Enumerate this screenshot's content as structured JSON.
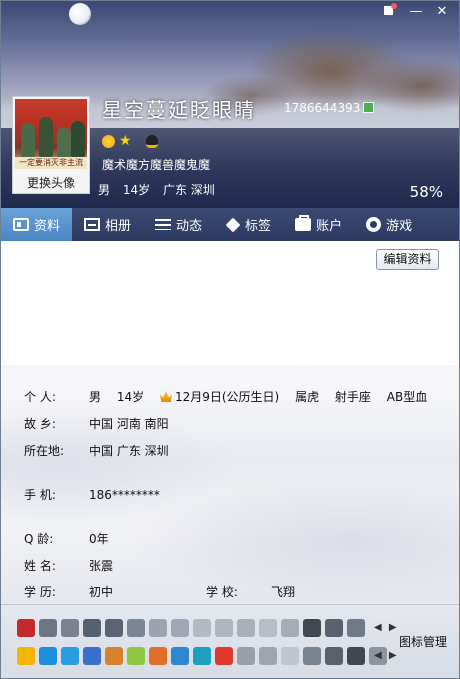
{
  "window": {
    "controls": {
      "skin": "",
      "minimize": "—",
      "close": "✕"
    }
  },
  "profile": {
    "nickname": "星空蔓延眨眼睛",
    "qq_number": "1786644393",
    "avatar_caption": "一定要消灭非主流",
    "change_avatar_label": "更换头像",
    "signature": "魔术魔方魔兽魔鬼魔",
    "gender": "男",
    "age": "14岁",
    "location": "广东 深圳",
    "completion": "58%"
  },
  "tabs": [
    {
      "label": "资料",
      "icon": "profile-card-icon",
      "active": true
    },
    {
      "label": "相册",
      "icon": "album-icon",
      "active": false
    },
    {
      "label": "动态",
      "icon": "feed-list-icon",
      "active": false
    },
    {
      "label": "标签",
      "icon": "tag-icon",
      "active": false
    },
    {
      "label": "账户",
      "icon": "wallet-icon",
      "active": false
    },
    {
      "label": "游戏",
      "icon": "game-icon",
      "active": false
    }
  ],
  "edit_button": "编辑资料",
  "details": {
    "personal": {
      "label": "个    人:",
      "gender": "男",
      "age": "14岁",
      "birthday": "12月9日(公历生日)",
      "zodiac": "属虎",
      "constellation": "射手座",
      "blood": "AB型血"
    },
    "hometown": {
      "label": "故    乡:",
      "value": "中国 河南 南阳"
    },
    "residence": {
      "label": "所在地:",
      "value": "中国 广东 深圳"
    },
    "mobile": {
      "label": "手    机:",
      "value": "186********"
    },
    "qage": {
      "label": "Q    龄:",
      "value": "0年"
    },
    "name": {
      "label": "姓    名:",
      "value": "张震"
    },
    "education": {
      "label": "学    历:",
      "value": "初中"
    },
    "school": {
      "label": "学    校:",
      "value": "飞翔"
    }
  },
  "iconbar": {
    "row1_colors": [
      "#c2282c",
      "#6c7684",
      "#7a8190",
      "#55606e",
      "#5b6472",
      "#7a8595",
      "#9aa3b0",
      "#a0a8b5",
      "#b3bac6",
      "#aeb5c1",
      "#a9b0bc",
      "#b8bec9",
      "#a5acb8",
      "#404850",
      "#596370",
      "#707a88"
    ],
    "row2_colors": [
      "#f3b400",
      "#1b8fd8",
      "#2a9de0",
      "#3a70c8",
      "#d7812a",
      "#8ec640",
      "#e2702b",
      "#2f86d0",
      "#20a0c0",
      "#e03a2f",
      "#9a9ea8",
      "#9ea4b0",
      "#bfc6d2",
      "#7a8390",
      "#59616c",
      "#3f4752",
      "#8d949e"
    ],
    "arrows": "◀ ▶",
    "manage_label": "图标管理"
  }
}
